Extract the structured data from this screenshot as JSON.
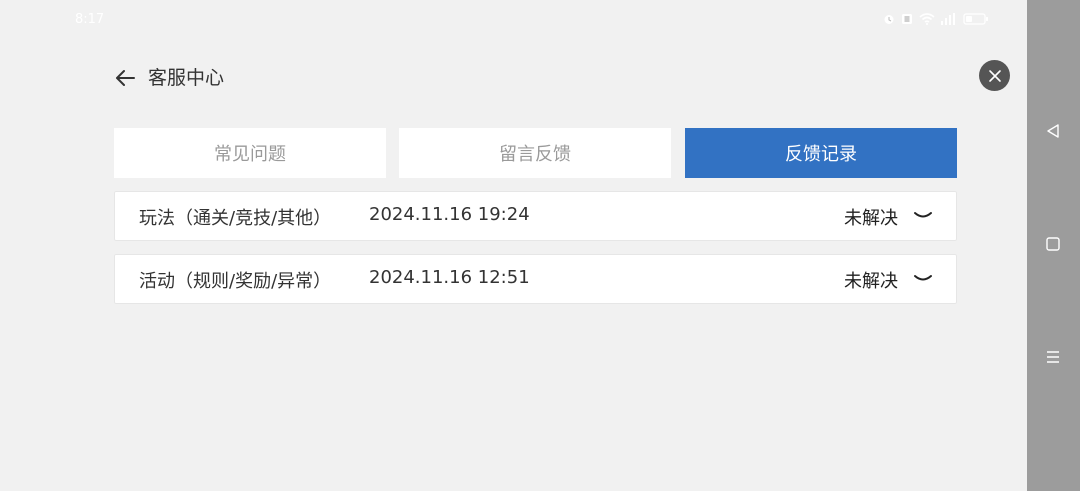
{
  "status_bar": {
    "time": "8:17",
    "icons": [
      "alarm-icon",
      "vibrate-icon",
      "wifi-icon",
      "signal-icon",
      "battery-icon"
    ]
  },
  "header": {
    "back_icon": "arrow-left-icon",
    "title": "客服中心",
    "close_icon": "close-icon"
  },
  "tabs": [
    {
      "label": "常见问题",
      "active": false
    },
    {
      "label": "留言反馈",
      "active": false
    },
    {
      "label": "反馈记录",
      "active": true
    }
  ],
  "records": [
    {
      "category": "玩法（通关/竞技/其他）",
      "time": "2024.11.16 19:24",
      "status": "未解决",
      "icon": "chevron-down-icon"
    },
    {
      "category": "活动（规则/奖励/异常）",
      "time": "2024.11.16 12:51",
      "status": "未解决",
      "icon": "chevron-down-icon"
    }
  ],
  "nav_bar": {
    "icons": [
      "back-triangle-icon",
      "home-square-icon",
      "menu-lines-icon"
    ]
  },
  "colors": {
    "accent": "#3272c3",
    "background": "#f1f1f1",
    "nav_bar": "#9c9c9c"
  }
}
